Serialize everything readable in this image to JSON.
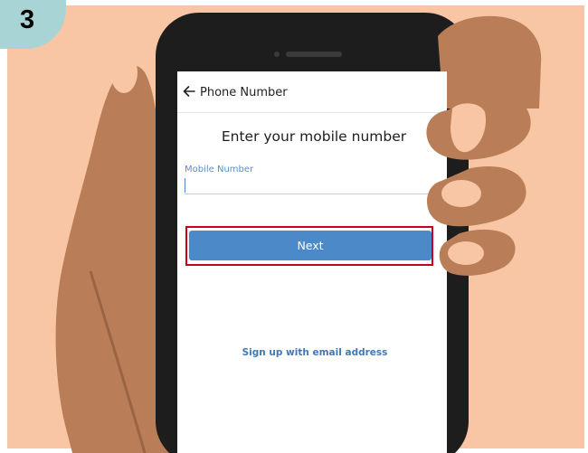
{
  "step": {
    "number": "3"
  },
  "screen": {
    "header": {
      "back_icon": "arrow-left-icon",
      "title": "Phone Number"
    },
    "heading": "Enter your mobile number",
    "mobile_field": {
      "label": "Mobile Number",
      "value": "",
      "placeholder": ""
    },
    "next_button": {
      "label": "Next"
    },
    "email_link": {
      "label": "Sign up with email address"
    }
  },
  "colors": {
    "background": "#f9c6a5",
    "skin": "#b97e58",
    "skin_dark": "#9a6444",
    "nail": "#f9c6a5",
    "phone_body": "#1d1d1d",
    "step_badge": "#a9d4d6",
    "accent": "#4c89c9",
    "link": "#3f79b9",
    "highlight": "#c8001e"
  }
}
